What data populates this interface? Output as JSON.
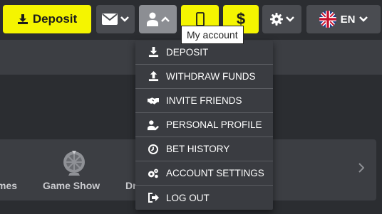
{
  "header": {
    "deposit_label": "Deposit",
    "dollar_label": "$",
    "language_label": "EN",
    "tooltip": "My account"
  },
  "account_menu": {
    "items": [
      {
        "label": "DEPOSIT",
        "icon": "download-icon"
      },
      {
        "label": "WITHDRAW FUNDS",
        "icon": "upload-icon"
      },
      {
        "label": "INVITE FRIENDS",
        "icon": "handshake-icon"
      },
      {
        "label": "PERSONAL PROFILE",
        "icon": "user-edit-icon"
      },
      {
        "label": "BET HISTORY",
        "icon": "clock-icon"
      },
      {
        "label": "ACCOUNT SETTINGS",
        "icon": "cogs-icon"
      },
      {
        "label": "LOG OUT",
        "icon": "sign-out-icon"
      }
    ]
  },
  "categories": {
    "partial_left": "mes",
    "game_show": "Game Show",
    "partial_right": "Dr"
  },
  "colors": {
    "accent_yellow": "#f5f500",
    "background": "#2b2d31",
    "panel": "#3c3e43",
    "button_dark": "#4a4c51",
    "button_active": "#8c8e93"
  }
}
